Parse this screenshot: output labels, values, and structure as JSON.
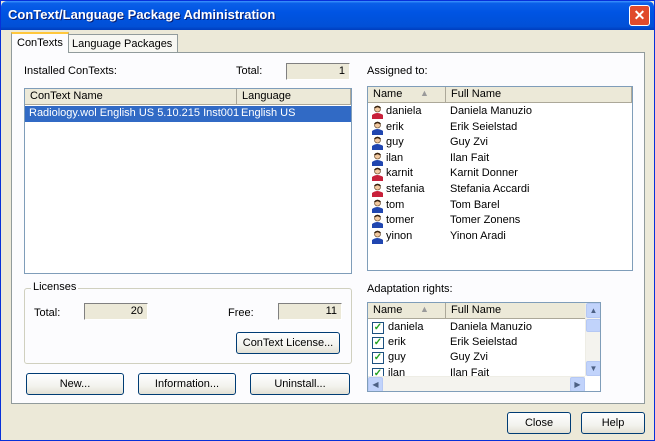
{
  "window": {
    "title": "ConText/Language Package Administration"
  },
  "tabs": [
    {
      "label": "ConTexts",
      "active": true
    },
    {
      "label": "Language Packages",
      "active": false
    }
  ],
  "installed": {
    "label": "Installed ConTexts:",
    "total_label": "Total:",
    "total_value": "1",
    "columns": [
      "ConText Name",
      "Language"
    ],
    "rows": [
      {
        "name": "Radiology.wol  English US  5.10.215  Inst001",
        "language": "English US",
        "selected": true
      }
    ]
  },
  "assigned": {
    "label": "Assigned to:",
    "columns": [
      "Name",
      "Full Name"
    ],
    "rows": [
      {
        "name": "daniela",
        "full": "Daniela Manuzio",
        "gender": "female"
      },
      {
        "name": "erik",
        "full": "Erik Seielstad",
        "gender": "male"
      },
      {
        "name": "guy",
        "full": "Guy Zvi",
        "gender": "male"
      },
      {
        "name": "ilan",
        "full": "Ilan Fait",
        "gender": "male"
      },
      {
        "name": "karnit",
        "full": "Karnit Donner",
        "gender": "female"
      },
      {
        "name": "stefania",
        "full": "Stefania Accardi",
        "gender": "female"
      },
      {
        "name": "tom",
        "full": "Tom Barel",
        "gender": "male"
      },
      {
        "name": "tomer",
        "full": "Tomer Zonens",
        "gender": "male"
      },
      {
        "name": "yinon",
        "full": "Yinon Aradi",
        "gender": "male"
      }
    ]
  },
  "licenses": {
    "title": "Licenses",
    "total_label": "Total:",
    "total_value": "20",
    "free_label": "Free:",
    "free_value": "11",
    "license_button": "ConText License..."
  },
  "adaptation": {
    "label": "Adaptation rights:",
    "columns": [
      "Name",
      "Full Name"
    ],
    "rows": [
      {
        "name": "daniela",
        "full": "Daniela Manuzio",
        "checked": true
      },
      {
        "name": "erik",
        "full": "Erik Seielstad",
        "checked": true
      },
      {
        "name": "guy",
        "full": "Guy Zvi",
        "checked": true
      },
      {
        "name": "ilan",
        "full": "Ilan Fait",
        "checked": true
      }
    ]
  },
  "actions": {
    "new": "New...",
    "information": "Information...",
    "uninstall": "Uninstall..."
  },
  "footer": {
    "close": "Close",
    "help": "Help"
  },
  "colors": {
    "female": "#c8203a",
    "male": "#2046b0",
    "selection": "#316ac5"
  }
}
